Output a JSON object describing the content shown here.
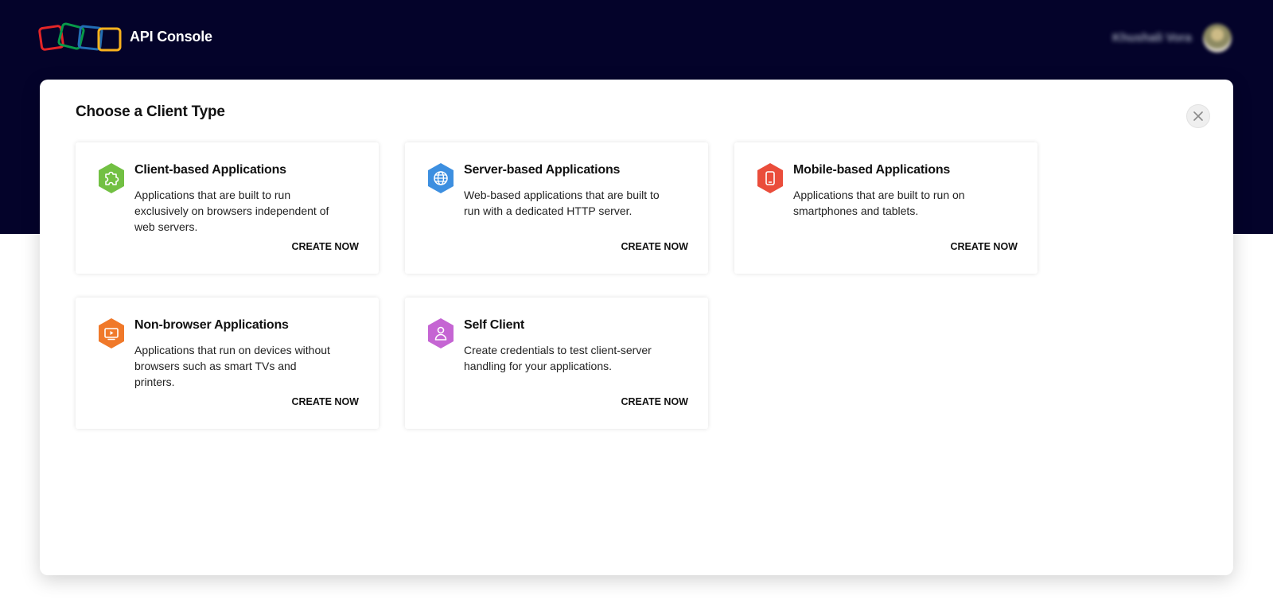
{
  "header": {
    "app_title": "API Console",
    "user_name": "Khushali Vora",
    "logo_colors": [
      "#e42527",
      "#089949",
      "#226db4",
      "#f9b21d"
    ],
    "background_color": "#04032a"
  },
  "modal": {
    "title": "Choose a Client Type"
  },
  "client_types": [
    {
      "title": "Client-based Applications",
      "description": "Applications that are built to run exclusively on browsers independent of web servers.",
      "action": "CREATE NOW",
      "icon": "puzzle-icon",
      "color": "#72c043"
    },
    {
      "title": "Server-based Applications",
      "description": "Web-based applications that are built to run with a dedicated HTTP server.",
      "action": "CREATE NOW",
      "icon": "globe-icon",
      "color": "#3d8fe0"
    },
    {
      "title": "Mobile-based Applications",
      "description": "Applications that are built to run on smartphones and tablets.",
      "action": "CREATE NOW",
      "icon": "mobile-phone-icon",
      "color": "#ea4d3b"
    },
    {
      "title": "Non-browser Applications",
      "description": "Applications that run on devices without browsers such as smart TVs and printers.",
      "action": "CREATE NOW",
      "icon": "tv-icon",
      "color": "#f0792a"
    },
    {
      "title": "Self Client",
      "description": "Create credentials to test client-server handling for your applications.",
      "action": "CREATE NOW",
      "icon": "user-icon",
      "color": "#c565d3"
    }
  ]
}
